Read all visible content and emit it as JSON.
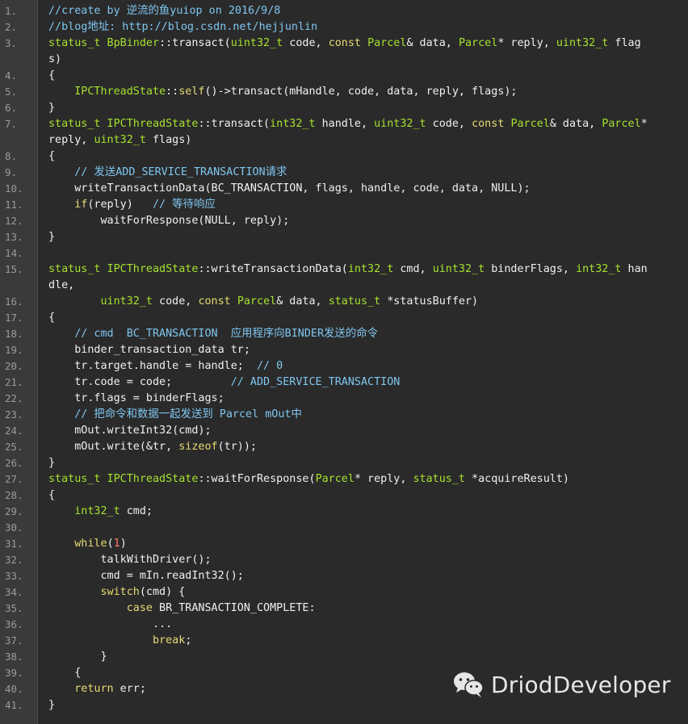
{
  "editor": {
    "lines": [
      {
        "n": "1.",
        "tokens": [
          {
            "t": "//create by 逆流的鱼yuiop on 2016/9/8",
            "c": "cmt"
          }
        ]
      },
      {
        "n": "2.",
        "tokens": [
          {
            "t": "//blog地址: http://blog.csdn.net/hejjunlin",
            "c": "cmt"
          }
        ]
      },
      {
        "n": "3.",
        "tokens": [
          {
            "t": "status_t BpBinder",
            "c": "typ"
          },
          {
            "t": "::transact(",
            "c": "pl"
          },
          {
            "t": "uint32_t",
            "c": "typ"
          },
          {
            "t": " code, ",
            "c": "pl"
          },
          {
            "t": "const",
            "c": "kw"
          },
          {
            "t": " ",
            "c": "pl"
          },
          {
            "t": "Parcel",
            "c": "typ"
          },
          {
            "t": "& data, ",
            "c": "pl"
          },
          {
            "t": "Parcel",
            "c": "typ"
          },
          {
            "t": "* reply, ",
            "c": "pl"
          },
          {
            "t": "uint32_t",
            "c": "typ"
          },
          {
            "t": " flag",
            "c": "pl"
          }
        ]
      },
      {
        "n": "",
        "tokens": [
          {
            "t": "s)",
            "c": "pl"
          }
        ]
      },
      {
        "n": "4.",
        "tokens": [
          {
            "t": "{",
            "c": "pl"
          }
        ]
      },
      {
        "n": "5.",
        "tokens": [
          {
            "t": "    ",
            "c": "pl"
          },
          {
            "t": "IPCThreadState",
            "c": "typ"
          },
          {
            "t": "::",
            "c": "pl"
          },
          {
            "t": "self",
            "c": "kw"
          },
          {
            "t": "()->transact(mHandle, code, data, reply, flags);",
            "c": "pl"
          }
        ]
      },
      {
        "n": "6.",
        "tokens": [
          {
            "t": "}",
            "c": "pl"
          }
        ]
      },
      {
        "n": "7.",
        "tokens": [
          {
            "t": "status_t IPCThreadState",
            "c": "typ"
          },
          {
            "t": "::transact(",
            "c": "pl"
          },
          {
            "t": "int32_t",
            "c": "typ"
          },
          {
            "t": " handle, ",
            "c": "pl"
          },
          {
            "t": "uint32_t",
            "c": "typ"
          },
          {
            "t": " code, ",
            "c": "pl"
          },
          {
            "t": "const",
            "c": "kw"
          },
          {
            "t": " ",
            "c": "pl"
          },
          {
            "t": "Parcel",
            "c": "typ"
          },
          {
            "t": "& data, ",
            "c": "pl"
          },
          {
            "t": "Parcel",
            "c": "typ"
          },
          {
            "t": "*",
            "c": "pl"
          }
        ]
      },
      {
        "n": "",
        "tokens": [
          {
            "t": "reply, ",
            "c": "pl"
          },
          {
            "t": "uint32_t",
            "c": "typ"
          },
          {
            "t": " flags)",
            "c": "pl"
          }
        ]
      },
      {
        "n": "8.",
        "tokens": [
          {
            "t": "{",
            "c": "pl"
          }
        ]
      },
      {
        "n": "9.",
        "tokens": [
          {
            "t": "    // 发送ADD_SERVICE_TRANSACTION请求",
            "c": "cmt"
          }
        ]
      },
      {
        "n": "10.",
        "tokens": [
          {
            "t": "    writeTransactionData(BC_TRANSACTION, flags, handle, code, data, NULL);",
            "c": "pl"
          }
        ]
      },
      {
        "n": "11.",
        "tokens": [
          {
            "t": "    ",
            "c": "pl"
          },
          {
            "t": "if",
            "c": "kw"
          },
          {
            "t": "(reply)   ",
            "c": "pl"
          },
          {
            "t": "// 等待响应",
            "c": "cmt"
          }
        ]
      },
      {
        "n": "12.",
        "tokens": [
          {
            "t": "        waitForResponse(NULL, reply);",
            "c": "pl"
          }
        ]
      },
      {
        "n": "13.",
        "tokens": [
          {
            "t": "}",
            "c": "pl"
          }
        ]
      },
      {
        "n": "14.",
        "tokens": []
      },
      {
        "n": "15.",
        "tokens": [
          {
            "t": "status_t IPCThreadState",
            "c": "typ"
          },
          {
            "t": "::writeTransactionData(",
            "c": "pl"
          },
          {
            "t": "int32_t",
            "c": "typ"
          },
          {
            "t": " cmd, ",
            "c": "pl"
          },
          {
            "t": "uint32_t",
            "c": "typ"
          },
          {
            "t": " binderFlags, ",
            "c": "pl"
          },
          {
            "t": "int32_t",
            "c": "typ"
          },
          {
            "t": " han",
            "c": "pl"
          }
        ]
      },
      {
        "n": "",
        "tokens": [
          {
            "t": "dle,",
            "c": "pl"
          }
        ]
      },
      {
        "n": "16.",
        "tokens": [
          {
            "t": "        ",
            "c": "pl"
          },
          {
            "t": "uint32_t",
            "c": "typ"
          },
          {
            "t": " code, ",
            "c": "pl"
          },
          {
            "t": "const",
            "c": "kw"
          },
          {
            "t": " ",
            "c": "pl"
          },
          {
            "t": "Parcel",
            "c": "typ"
          },
          {
            "t": "& data, ",
            "c": "pl"
          },
          {
            "t": "status_t",
            "c": "typ"
          },
          {
            "t": " *statusBuffer)",
            "c": "pl"
          }
        ]
      },
      {
        "n": "17.",
        "tokens": [
          {
            "t": "{",
            "c": "pl"
          }
        ]
      },
      {
        "n": "18.",
        "tokens": [
          {
            "t": "    // cmd  BC_TRANSACTION  应用程序向BINDER发送的命令",
            "c": "cmt"
          }
        ]
      },
      {
        "n": "19.",
        "tokens": [
          {
            "t": "    binder_transaction_data tr;",
            "c": "pl"
          }
        ]
      },
      {
        "n": "20.",
        "tokens": [
          {
            "t": "    tr.target.handle = handle;  ",
            "c": "pl"
          },
          {
            "t": "// 0",
            "c": "cmt"
          }
        ]
      },
      {
        "n": "21.",
        "tokens": [
          {
            "t": "    tr.code = code;         ",
            "c": "pl"
          },
          {
            "t": "// ADD_SERVICE_TRANSACTION",
            "c": "cmt"
          }
        ]
      },
      {
        "n": "22.",
        "tokens": [
          {
            "t": "    tr.flags = binderFlags;",
            "c": "pl"
          }
        ]
      },
      {
        "n": "23.",
        "tokens": [
          {
            "t": "    // 把命令和数据一起发送到 Parcel mOut中",
            "c": "cmt"
          }
        ]
      },
      {
        "n": "24.",
        "tokens": [
          {
            "t": "    mOut.writeInt32(cmd);",
            "c": "pl"
          }
        ]
      },
      {
        "n": "25.",
        "tokens": [
          {
            "t": "    mOut.write(&tr, ",
            "c": "pl"
          },
          {
            "t": "sizeof",
            "c": "kw"
          },
          {
            "t": "(tr));",
            "c": "pl"
          }
        ]
      },
      {
        "n": "26.",
        "tokens": [
          {
            "t": "}",
            "c": "pl"
          }
        ]
      },
      {
        "n": "27.",
        "tokens": [
          {
            "t": "status_t IPCThreadState",
            "c": "typ"
          },
          {
            "t": "::waitForResponse(",
            "c": "pl"
          },
          {
            "t": "Parcel",
            "c": "typ"
          },
          {
            "t": "* reply, ",
            "c": "pl"
          },
          {
            "t": "status_t",
            "c": "typ"
          },
          {
            "t": " *acquireResult)",
            "c": "pl"
          }
        ]
      },
      {
        "n": "28.",
        "tokens": [
          {
            "t": "{",
            "c": "pl"
          }
        ]
      },
      {
        "n": "29.",
        "tokens": [
          {
            "t": "    ",
            "c": "pl"
          },
          {
            "t": "int32_t",
            "c": "typ"
          },
          {
            "t": " cmd;",
            "c": "pl"
          }
        ]
      },
      {
        "n": "30.",
        "tokens": []
      },
      {
        "n": "31.",
        "tokens": [
          {
            "t": "    ",
            "c": "pl"
          },
          {
            "t": "while",
            "c": "kw"
          },
          {
            "t": "(",
            "c": "pl"
          },
          {
            "t": "1",
            "c": "num"
          },
          {
            "t": ")",
            "c": "pl"
          }
        ]
      },
      {
        "n": "32.",
        "tokens": [
          {
            "t": "        talkWithDriver();",
            "c": "pl"
          }
        ]
      },
      {
        "n": "33.",
        "tokens": [
          {
            "t": "        cmd = mIn.readInt32();",
            "c": "pl"
          }
        ]
      },
      {
        "n": "34.",
        "tokens": [
          {
            "t": "        ",
            "c": "pl"
          },
          {
            "t": "switch",
            "c": "kw"
          },
          {
            "t": "(cmd) {",
            "c": "pl"
          }
        ]
      },
      {
        "n": "35.",
        "tokens": [
          {
            "t": "            ",
            "c": "pl"
          },
          {
            "t": "case",
            "c": "kw"
          },
          {
            "t": " BR_TRANSACTION_COMPLETE:",
            "c": "pl"
          }
        ]
      },
      {
        "n": "36.",
        "tokens": [
          {
            "t": "                ...",
            "c": "pl"
          }
        ]
      },
      {
        "n": "37.",
        "tokens": [
          {
            "t": "                ",
            "c": "pl"
          },
          {
            "t": "break",
            "c": "kw"
          },
          {
            "t": ";",
            "c": "pl"
          }
        ]
      },
      {
        "n": "38.",
        "tokens": [
          {
            "t": "        }",
            "c": "pl"
          }
        ]
      },
      {
        "n": "39.",
        "tokens": [
          {
            "t": "    {",
            "c": "pl"
          }
        ]
      },
      {
        "n": "40.",
        "tokens": [
          {
            "t": "    ",
            "c": "pl"
          },
          {
            "t": "return",
            "c": "kw"
          },
          {
            "t": " err;",
            "c": "pl"
          }
        ]
      },
      {
        "n": "41.",
        "tokens": [
          {
            "t": "}",
            "c": "pl"
          }
        ]
      }
    ]
  },
  "watermark": {
    "icon": "wechat-icon",
    "text": "DriodDeveloper"
  },
  "colors": {
    "comment": "#7fc6f0",
    "type": "#a6e22e",
    "keyword": "#e6db74",
    "number": "#fd7b6c",
    "plain": "#f0f0f0",
    "background": "#2a2a2a",
    "gutter": "#3a3a3a"
  }
}
